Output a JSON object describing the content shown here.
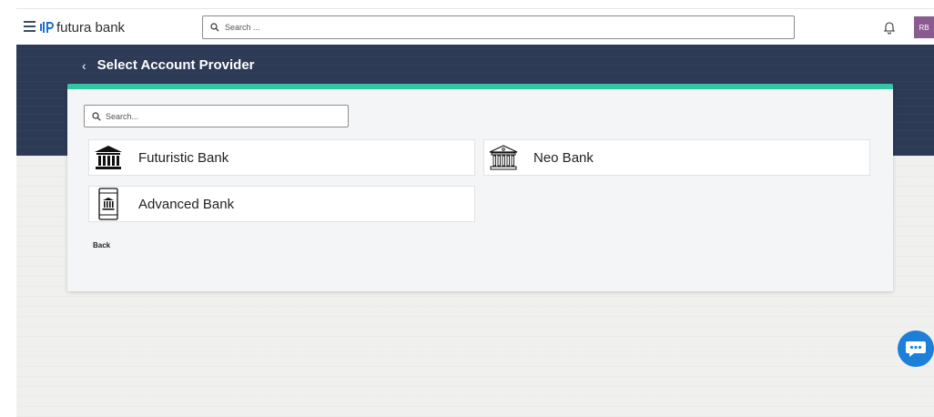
{
  "header": {
    "brand": "futura bank",
    "search_placeholder": "Search ...",
    "avatar_initials": "RB"
  },
  "banner": {
    "title": "Select Account Provider"
  },
  "card": {
    "search_placeholder": "Search...",
    "providers": [
      {
        "name": "Futuristic Bank",
        "icon": "bank-building-solid-icon"
      },
      {
        "name": "Neo Bank",
        "icon": "bank-building-outline-icon"
      },
      {
        "name": "Advanced Bank",
        "icon": "mobile-bank-icon"
      }
    ],
    "back_label": "Back"
  },
  "colors": {
    "banner": "#2c3a55",
    "accent": "#33c6a5",
    "avatar": "#8a5b8f",
    "chat": "#1e7fd8"
  }
}
